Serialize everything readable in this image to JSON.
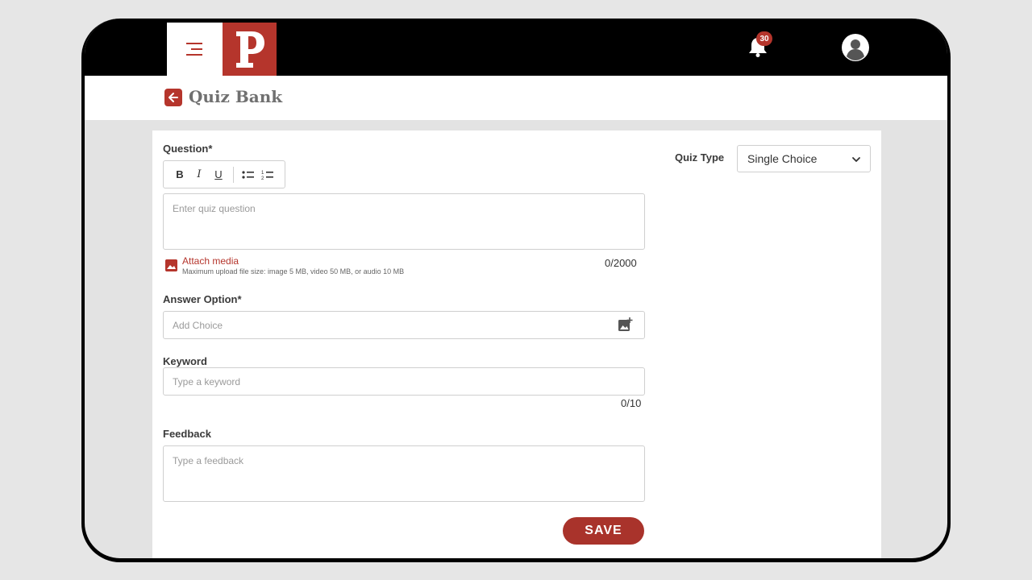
{
  "header": {
    "notifications_count": "30"
  },
  "page": {
    "title": "Quiz Bank"
  },
  "form": {
    "question_label": "Question*",
    "toolbar": {
      "bold": "B",
      "italic": "I",
      "underline": "U"
    },
    "question_placeholder": "Enter quiz question",
    "question_counter": "0/2000",
    "attach_label": "Attach media",
    "attach_hint": "Maximum upload file size: image 5 MB, video 50 MB, or audio 10 MB",
    "answer_label": "Answer Option*",
    "answer_placeholder": "Add Choice",
    "keyword_label": "Keyword",
    "keyword_placeholder": "Type a keyword",
    "keyword_counter": "0/10",
    "feedback_label": "Feedback",
    "feedback_placeholder": "Type a feedback",
    "save_label": "SAVE"
  },
  "quiz_type": {
    "label": "Quiz Type",
    "selected": "Single Choice"
  },
  "colors": {
    "accent": "#b5352c",
    "topbar": "#000000",
    "background": "#e3e3e3"
  },
  "icons": [
    "menu-icon",
    "logo-icon",
    "bell-icon",
    "avatar-icon",
    "back-arrow-icon",
    "bullet-list-icon",
    "numbered-list-icon",
    "image-icon",
    "image-add-icon",
    "chevron-down-icon"
  ]
}
